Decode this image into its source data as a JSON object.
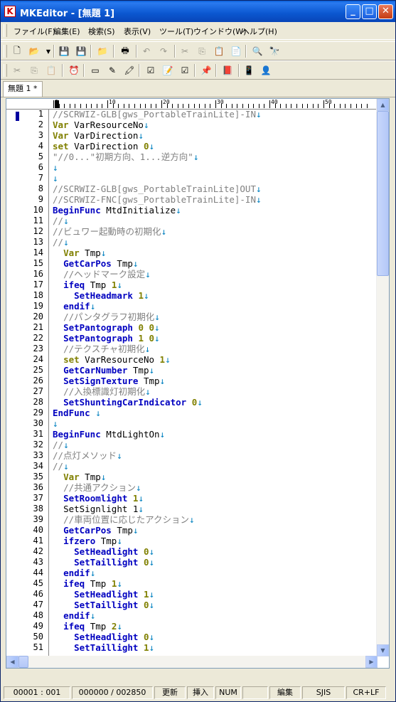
{
  "window": {
    "title": "MKEditor - [無題 1]",
    "controls": {
      "minimize": "_",
      "maximize": "□",
      "close": "✕"
    }
  },
  "menu": [
    "ファイル(F)",
    "編集(E)",
    "検索(S)",
    "表示(V)",
    "ツール(T)",
    "ウインドウ(W)",
    "ヘルプ(H)"
  ],
  "tabs": [
    {
      "label": "無題 1 *"
    }
  ],
  "ruler": {
    "marks": [
      "0",
      "10",
      "20",
      "30",
      "40",
      "50"
    ]
  },
  "editor": {
    "lines": [
      [
        {
          "t": "//SCRWIZ-GLB[gws_PortableTrainLite]-IN",
          "c": "comment"
        }
      ],
      [
        {
          "t": "Var",
          "c": "var"
        },
        {
          "t": " VarResourceNo",
          "c": "text"
        }
      ],
      [
        {
          "t": "Var",
          "c": "var"
        },
        {
          "t": " VarDirection",
          "c": "text"
        }
      ],
      [
        {
          "t": "set",
          "c": "var"
        },
        {
          "t": " VarDirection ",
          "c": "text"
        },
        {
          "t": "0",
          "c": "num"
        }
      ],
      [
        {
          "t": "\"//0...\"初期方向、1...逆方向\"",
          "c": "comment"
        }
      ],
      [],
      [],
      [
        {
          "t": "//SCRWIZ-GLB[gws_PortableTrainLite]OUT",
          "c": "comment"
        }
      ],
      [
        {
          "t": "//SCRWIZ-FNC[gws_PortableTrainLite]-IN",
          "c": "comment"
        }
      ],
      [
        {
          "t": "BeginFunc",
          "c": "kw"
        },
        {
          "t": " MtdInitialize",
          "c": "text"
        }
      ],
      [
        {
          "t": "//",
          "c": "comment"
        }
      ],
      [
        {
          "t": "//ビュワー起動時の初期化",
          "c": "comment"
        }
      ],
      [
        {
          "t": "//",
          "c": "comment"
        }
      ],
      [
        {
          "t": "  "
        },
        {
          "t": "Var",
          "c": "var"
        },
        {
          "t": " Tmp",
          "c": "text"
        }
      ],
      [
        {
          "t": "  "
        },
        {
          "t": "GetCarPos",
          "c": "kw"
        },
        {
          "t": " Tmp",
          "c": "text"
        }
      ],
      [
        {
          "t": "  "
        },
        {
          "t": "//ヘッドマーク設定",
          "c": "comment"
        }
      ],
      [
        {
          "t": "  "
        },
        {
          "t": "ifeq",
          "c": "kw"
        },
        {
          "t": " Tmp ",
          "c": "text"
        },
        {
          "t": "1",
          "c": "num"
        }
      ],
      [
        {
          "t": "    "
        },
        {
          "t": "SetHeadmark",
          "c": "kw"
        },
        {
          "t": " ",
          "c": "text"
        },
        {
          "t": "1",
          "c": "num"
        }
      ],
      [
        {
          "t": "  "
        },
        {
          "t": "endif",
          "c": "kw"
        }
      ],
      [
        {
          "t": "  "
        },
        {
          "t": "//パンタグラフ初期化",
          "c": "comment"
        }
      ],
      [
        {
          "t": "  "
        },
        {
          "t": "SetPantograph",
          "c": "kw"
        },
        {
          "t": " ",
          "c": "text"
        },
        {
          "t": "0 0",
          "c": "num"
        }
      ],
      [
        {
          "t": "  "
        },
        {
          "t": "SetPantograph",
          "c": "kw"
        },
        {
          "t": " ",
          "c": "text"
        },
        {
          "t": "1 0",
          "c": "num"
        }
      ],
      [
        {
          "t": "  "
        },
        {
          "t": "//テクスチャ初期化",
          "c": "comment"
        }
      ],
      [
        {
          "t": "  "
        },
        {
          "t": "set",
          "c": "var"
        },
        {
          "t": " VarResourceNo ",
          "c": "text"
        },
        {
          "t": "1",
          "c": "num"
        }
      ],
      [
        {
          "t": "  "
        },
        {
          "t": "GetCarNumber",
          "c": "kw"
        },
        {
          "t": " Tmp",
          "c": "text"
        }
      ],
      [
        {
          "t": "  "
        },
        {
          "t": "SetSignTexture",
          "c": "kw"
        },
        {
          "t": " Tmp",
          "c": "text"
        }
      ],
      [
        {
          "t": "  "
        },
        {
          "t": "//入換標識灯初期化",
          "c": "comment"
        }
      ],
      [
        {
          "t": "  "
        },
        {
          "t": "SetShuntingCarIndicator",
          "c": "kw"
        },
        {
          "t": " ",
          "c": "text"
        },
        {
          "t": "0",
          "c": "num"
        }
      ],
      [
        {
          "t": "EndFunc",
          "c": "kw"
        },
        {
          "t": " ",
          "c": "text"
        }
      ],
      [],
      [
        {
          "t": "BeginFunc",
          "c": "kw"
        },
        {
          "t": " MtdLightOn",
          "c": "text"
        }
      ],
      [
        {
          "t": "//",
          "c": "comment"
        }
      ],
      [
        {
          "t": "//点灯メソッド",
          "c": "comment"
        }
      ],
      [
        {
          "t": "//",
          "c": "comment"
        }
      ],
      [
        {
          "t": "  "
        },
        {
          "t": "Var",
          "c": "var"
        },
        {
          "t": " Tmp",
          "c": "text"
        }
      ],
      [
        {
          "t": "  "
        },
        {
          "t": "//共通アクション",
          "c": "comment"
        }
      ],
      [
        {
          "t": "  "
        },
        {
          "t": "SetRoomlight",
          "c": "kw"
        },
        {
          "t": " ",
          "c": "text"
        },
        {
          "t": "1",
          "c": "num"
        }
      ],
      [
        {
          "t": "  "
        },
        {
          "t": "SetSignlight 1",
          "c": "text"
        }
      ],
      [
        {
          "t": "  "
        },
        {
          "t": "//車両位置に応じたアクション",
          "c": "comment"
        }
      ],
      [
        {
          "t": "  "
        },
        {
          "t": "GetCarPos",
          "c": "kw"
        },
        {
          "t": " Tmp",
          "c": "text"
        }
      ],
      [
        {
          "t": "  "
        },
        {
          "t": "ifzero",
          "c": "kw"
        },
        {
          "t": " Tmp",
          "c": "text"
        }
      ],
      [
        {
          "t": "    "
        },
        {
          "t": "SetHeadlight",
          "c": "kw"
        },
        {
          "t": " ",
          "c": "text"
        },
        {
          "t": "0",
          "c": "num"
        }
      ],
      [
        {
          "t": "    "
        },
        {
          "t": "SetTaillight",
          "c": "kw"
        },
        {
          "t": " ",
          "c": "text"
        },
        {
          "t": "0",
          "c": "num"
        }
      ],
      [
        {
          "t": "  "
        },
        {
          "t": "endif",
          "c": "kw"
        }
      ],
      [
        {
          "t": "  "
        },
        {
          "t": "ifeq",
          "c": "kw"
        },
        {
          "t": " Tmp ",
          "c": "text"
        },
        {
          "t": "1",
          "c": "num"
        }
      ],
      [
        {
          "t": "    "
        },
        {
          "t": "SetHeadlight",
          "c": "kw"
        },
        {
          "t": " ",
          "c": "text"
        },
        {
          "t": "1",
          "c": "num"
        }
      ],
      [
        {
          "t": "    "
        },
        {
          "t": "SetTaillight",
          "c": "kw"
        },
        {
          "t": " ",
          "c": "text"
        },
        {
          "t": "0",
          "c": "num"
        }
      ],
      [
        {
          "t": "  "
        },
        {
          "t": "endif",
          "c": "kw"
        }
      ],
      [
        {
          "t": "  "
        },
        {
          "t": "ifeq",
          "c": "kw"
        },
        {
          "t": " Tmp ",
          "c": "text"
        },
        {
          "t": "2",
          "c": "num"
        }
      ],
      [
        {
          "t": "    "
        },
        {
          "t": "SetHeadlight",
          "c": "kw"
        },
        {
          "t": " ",
          "c": "text"
        },
        {
          "t": "0",
          "c": "num"
        }
      ],
      [
        {
          "t": "    "
        },
        {
          "t": "SetTaillight",
          "c": "kw"
        },
        {
          "t": " ",
          "c": "text"
        },
        {
          "t": "1",
          "c": "num"
        }
      ]
    ],
    "eol_mark": "↓"
  },
  "status": {
    "position": "00001 : 001",
    "lines": "000000 / 002850",
    "mode": "更新",
    "insert": "挿入",
    "numlock": "NUM",
    "edit": "編集",
    "encoding": "SJIS",
    "newline": "CR+LF"
  },
  "colors": {
    "titlebar": "#0b57d0",
    "keyword": "#0000c0",
    "variable": "#808000",
    "comment": "#808080",
    "eol": "#0080c0"
  }
}
